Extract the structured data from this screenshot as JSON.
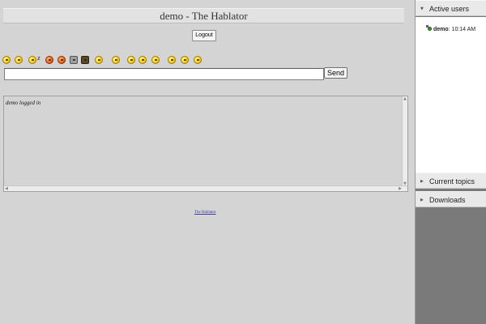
{
  "header": {
    "title": "demo - The Hablator"
  },
  "logout": {
    "label": "Logout"
  },
  "emoticons": [
    {
      "icon": "smile-emoticon"
    },
    {
      "icon": "grin-emoticon"
    },
    {
      "icon": "sleepy-emoticon"
    },
    {
      "icon": "no-emoticon"
    },
    {
      "icon": "angry-emoticon"
    },
    {
      "icon": "robot-emoticon"
    },
    {
      "icon": "pirate-emoticon"
    },
    {
      "icon": "cool-emoticon"
    },
    {
      "icon": "shocked-emoticon"
    },
    {
      "icon": "happy-emoticon"
    },
    {
      "icon": "wink-emoticon"
    },
    {
      "icon": "silly-emoticon"
    },
    {
      "icon": "surprised-emoticon"
    },
    {
      "icon": "sunglasses-emoticon"
    },
    {
      "icon": "laugh-emoticon"
    }
  ],
  "chat": {
    "input_value": "",
    "send_label": "Send",
    "log_lines": [
      "demo logged in"
    ]
  },
  "footer": {
    "link_text": "The Hablator"
  },
  "sidebar": {
    "active_users": {
      "label": "Active users",
      "users": [
        {
          "name": "demo",
          "time": "10:14 AM"
        }
      ]
    },
    "current_topics": {
      "label": "Current topics"
    },
    "downloads": {
      "label": "Downloads"
    }
  }
}
